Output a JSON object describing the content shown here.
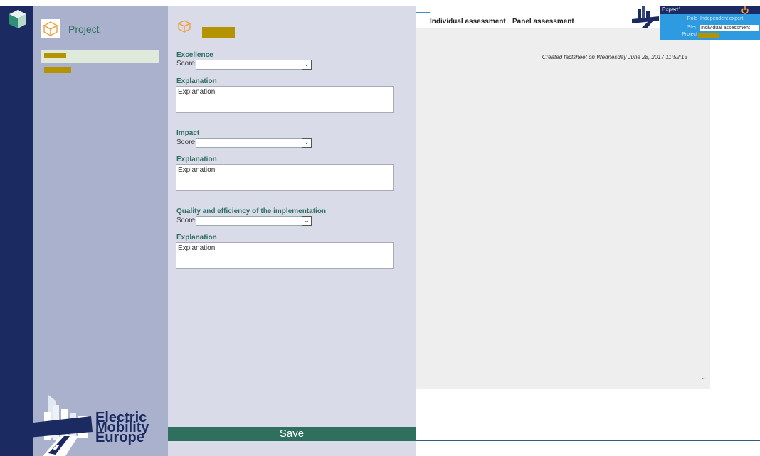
{
  "sidebar": {
    "title": "Project"
  },
  "form": {
    "sections": [
      {
        "title": "Excellence",
        "score_label": "Score",
        "explanation_label": "Explanation",
        "explanation_value": "Explanation"
      },
      {
        "title": "Impact",
        "score_label": "Score",
        "explanation_label": "Explanation",
        "explanation_value": "Explanation"
      },
      {
        "title": "Quality and efficiency of the implementation",
        "score_label": "Score",
        "explanation_label": "Explanation",
        "explanation_value": "Explanation"
      }
    ],
    "save_label": "Save"
  },
  "tabs": [
    {
      "label": "Individual assessment"
    },
    {
      "label": "Panel assessment"
    }
  ],
  "content": {
    "created_text": "Created factsheet on Wednesday June 28, 2017 11:52:13"
  },
  "user": {
    "name": "Expert1",
    "role_label": "Role",
    "role_value": "Independent expert",
    "step_label": "Step",
    "step_value": "Individual assessment",
    "project_label": "Project"
  },
  "brand": {
    "logo_text": "Electric Mobility Europe",
    "line1": "Electric",
    "line2": "Mobility",
    "line3": "Europe"
  },
  "colors": {
    "navy": "#1c2a62",
    "green": "#2f6f5d",
    "redaction": "#b39400",
    "user_blue": "#2e9be0"
  },
  "icons": {
    "project": "box-icon",
    "power": "power-icon",
    "app": "cube-icon"
  }
}
